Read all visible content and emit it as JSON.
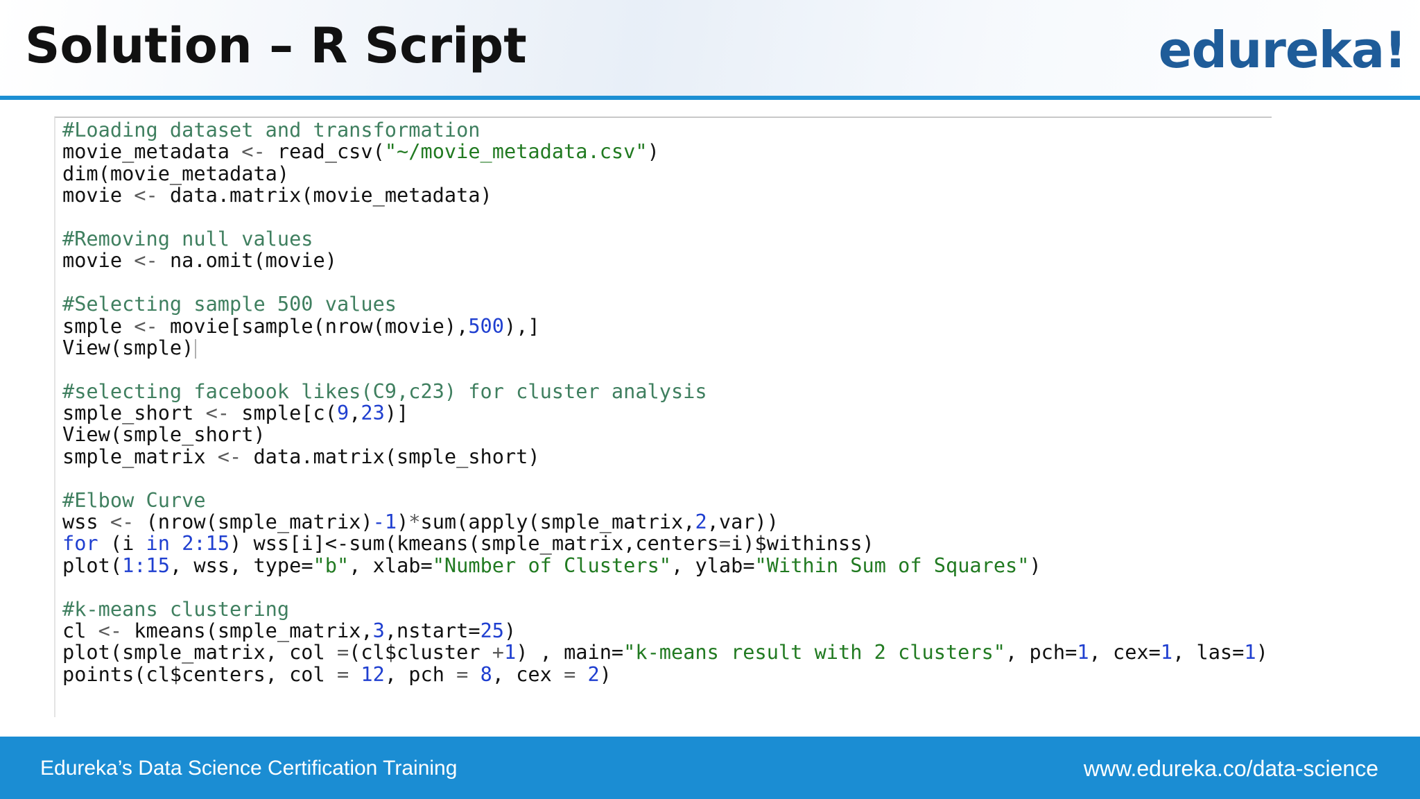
{
  "slide": {
    "title": "Solution – R Script",
    "logo_text": "edureka!",
    "footer_left": "Edureka’s Data Science Certification Training",
    "footer_right": "www.edureka.co/data-science"
  },
  "colors": {
    "accent_blue": "#1b8dd3",
    "logo_blue": "#1f5c99",
    "comment_green": "#3f7f5f",
    "string_green": "#217a21",
    "number_blue": "#1f3fd0"
  },
  "code": {
    "lines": [
      [
        [
          "comment",
          "#Loading dataset and transformation"
        ]
      ],
      [
        [
          "plain",
          "movie_metadata "
        ],
        [
          "op",
          "<-"
        ],
        [
          "plain",
          " read_csv("
        ],
        [
          "string",
          "\"~/movie_metadata.csv\""
        ],
        [
          "plain",
          ")"
        ]
      ],
      [
        [
          "plain",
          "dim(movie_metadata)"
        ]
      ],
      [
        [
          "plain",
          "movie "
        ],
        [
          "op",
          "<-"
        ],
        [
          "plain",
          " data.matrix(movie_metadata)"
        ]
      ],
      [],
      [
        [
          "comment",
          "#Removing null values"
        ]
      ],
      [
        [
          "plain",
          "movie "
        ],
        [
          "op",
          "<-"
        ],
        [
          "plain",
          " na.omit(movie)"
        ]
      ],
      [],
      [
        [
          "comment",
          "#Selecting sample 500 values"
        ]
      ],
      [
        [
          "plain",
          "smple "
        ],
        [
          "op",
          "<-"
        ],
        [
          "plain",
          " movie[sample(nrow(movie),"
        ],
        [
          "number",
          "500"
        ],
        [
          "plain",
          "),]"
        ]
      ],
      [
        [
          "plain",
          "View(smple)"
        ],
        [
          "cursor",
          ""
        ]
      ],
      [],
      [
        [
          "comment",
          "#selecting facebook likes(C9,c23) for cluster analysis"
        ]
      ],
      [
        [
          "plain",
          "smple_short "
        ],
        [
          "op",
          "<-"
        ],
        [
          "plain",
          " smple[c("
        ],
        [
          "number",
          "9"
        ],
        [
          "plain",
          ","
        ],
        [
          "number",
          "23"
        ],
        [
          "plain",
          ")]"
        ]
      ],
      [
        [
          "plain",
          "View(smple_short)"
        ]
      ],
      [
        [
          "plain",
          "smple_matrix "
        ],
        [
          "op",
          "<-"
        ],
        [
          "plain",
          " data.matrix(smple_short)"
        ]
      ],
      [],
      [
        [
          "comment",
          "#Elbow Curve"
        ]
      ],
      [
        [
          "plain",
          "wss "
        ],
        [
          "op",
          "<-"
        ],
        [
          "plain",
          " (nrow(smple_matrix)"
        ],
        [
          "number",
          "-1"
        ],
        [
          "plain",
          ")"
        ],
        [
          "op",
          "*"
        ],
        [
          "plain",
          "sum(apply(smple_matrix,"
        ],
        [
          "number",
          "2"
        ],
        [
          "plain",
          ",var))"
        ]
      ],
      [
        [
          "keyword",
          "for"
        ],
        [
          "plain",
          " (i "
        ],
        [
          "keyword",
          "in"
        ],
        [
          "plain",
          " "
        ],
        [
          "number",
          "2:15"
        ],
        [
          "plain",
          ") wss[i]<-sum(kmeans(smple_matrix,centers"
        ],
        [
          "op",
          "="
        ],
        [
          "plain",
          "i)$withinss)"
        ]
      ],
      [
        [
          "plain",
          "plot("
        ],
        [
          "number",
          "1:15"
        ],
        [
          "plain",
          ", wss, type="
        ],
        [
          "string",
          "\"b\""
        ],
        [
          "plain",
          ", xlab="
        ],
        [
          "string",
          "\"Number of Clusters\""
        ],
        [
          "plain",
          ", ylab="
        ],
        [
          "string",
          "\"Within Sum of Squares\""
        ],
        [
          "plain",
          ")"
        ]
      ],
      [],
      [
        [
          "comment",
          "#k-means clustering"
        ]
      ],
      [
        [
          "plain",
          "cl "
        ],
        [
          "op",
          "<-"
        ],
        [
          "plain",
          " kmeans(smple_matrix,"
        ],
        [
          "number",
          "3"
        ],
        [
          "plain",
          ",nstart="
        ],
        [
          "number",
          "25"
        ],
        [
          "plain",
          ")"
        ]
      ],
      [
        [
          "plain",
          "plot(smple_matrix, col "
        ],
        [
          "op",
          "="
        ],
        [
          "plain",
          "(cl$cluster "
        ],
        [
          "op",
          "+"
        ],
        [
          "number",
          "1"
        ],
        [
          "plain",
          ") , main="
        ],
        [
          "string",
          "\"k-means result with 2 clusters\""
        ],
        [
          "plain",
          ", pch="
        ],
        [
          "number",
          "1"
        ],
        [
          "plain",
          ", cex="
        ],
        [
          "number",
          "1"
        ],
        [
          "plain",
          ", las="
        ],
        [
          "number",
          "1"
        ],
        [
          "plain",
          ")"
        ]
      ],
      [
        [
          "plain",
          "points(cl$centers, col "
        ],
        [
          "op",
          "="
        ],
        [
          "plain",
          " "
        ],
        [
          "number",
          "12"
        ],
        [
          "plain",
          ", pch "
        ],
        [
          "op",
          "="
        ],
        [
          "plain",
          " "
        ],
        [
          "number",
          "8"
        ],
        [
          "plain",
          ", cex "
        ],
        [
          "op",
          "="
        ],
        [
          "plain",
          " "
        ],
        [
          "number",
          "2"
        ],
        [
          "plain",
          ")"
        ]
      ]
    ]
  }
}
